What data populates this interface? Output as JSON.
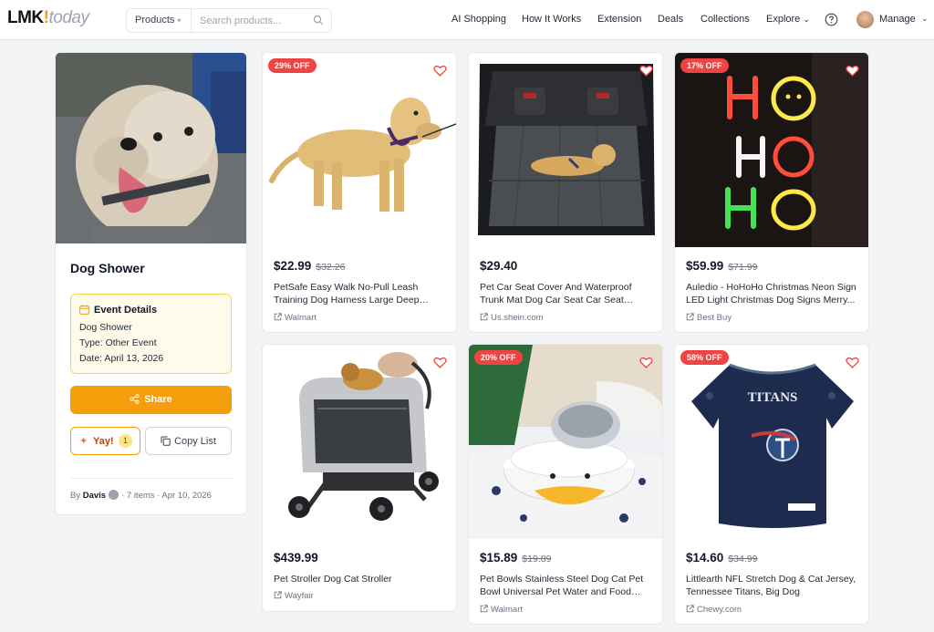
{
  "header": {
    "logo_main": "LMK",
    "logo_bang": "!",
    "logo_sub": "today",
    "category_label": "Products",
    "search_placeholder": "Search products...",
    "nav": [
      "AI Shopping",
      "How It Works",
      "Extension",
      "Deals",
      "Collections",
      "Explore"
    ],
    "manage_label": "Manage"
  },
  "list": {
    "title": "Dog Shower",
    "event_heading": "Event Details",
    "event_name": "Dog Shower",
    "event_type": "Type: Other Event",
    "event_date": "Date: April 13, 2026",
    "share_label": "Share",
    "yay_label": "Yay!",
    "yay_count": "1",
    "copy_label": "Copy List",
    "by_prefix": "By",
    "author": "Davis",
    "meta": "· 7 items · Apr 10, 2026"
  },
  "products": [
    {
      "badge": "29% OFF",
      "price": "$22.99",
      "old_price": "$32.26",
      "title": "PetSafe Easy Walk No-Pull Leash Training Dog Harness Large Deep Purple",
      "store": "Walmart"
    },
    {
      "badge": "",
      "price": "$29.40",
      "old_price": "",
      "title": "Pet Car Seat Cover And Waterproof Trunk Mat Dog Car Seat Car Seat Covers Dog...",
      "store": "Us.shein.com"
    },
    {
      "badge": "17% OFF",
      "price": "$59.99",
      "old_price": "$71.99",
      "title": "Auledio - HoHoHo Christmas Neon Sign LED Light Christmas Dog Signs Merry...",
      "store": "Best Buy"
    },
    {
      "badge": "",
      "price": "$439.99",
      "old_price": "",
      "title": "Pet Stroller Dog Cat Stroller",
      "store": "Wayfair"
    },
    {
      "badge": "20% OFF",
      "price": "$15.89",
      "old_price": "$19.89",
      "title": "Pet Bowls Stainless Steel Dog Cat Pet Bowl Universal Pet Water and Food Bowls",
      "store": "Walmart"
    },
    {
      "badge": "58% OFF",
      "price": "$14.60",
      "old_price": "$34.99",
      "title": "Littlearth NFL Stretch Dog & Cat Jersey, Tennessee Titans, Big Dog",
      "store": "Chewy.com"
    }
  ],
  "jersey_text": "TITANS",
  "colors": {
    "accent": "#f59e0b",
    "badge": "#ef4444",
    "heart": "#ef4444"
  }
}
